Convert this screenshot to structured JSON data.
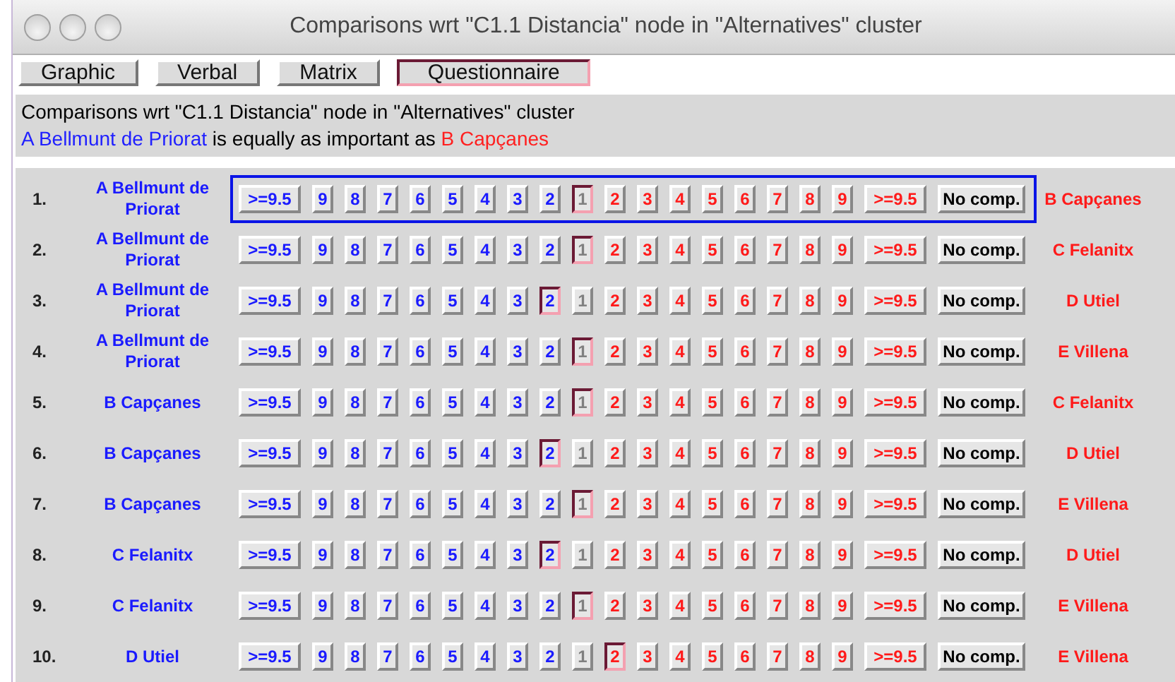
{
  "window": {
    "title": "Comparisons wrt \"C1.1 Distancia\" node in \"Alternatives\" cluster"
  },
  "tabs": [
    {
      "label": "Graphic",
      "selected": false
    },
    {
      "label": "Verbal",
      "selected": false
    },
    {
      "label": "Matrix",
      "selected": false
    },
    {
      "label": "Questionnaire",
      "selected": true
    }
  ],
  "info": {
    "heading": "Comparisons wrt \"C1.1 Distancia\" node in \"Alternatives\" cluster",
    "statement": [
      {
        "text": "A Bellmunt de Priorat",
        "color": "#2020ff"
      },
      {
        "text": " is equally as important as ",
        "color": "#000000"
      },
      {
        "text": "B Capçanes",
        "color": "#ff2020"
      }
    ]
  },
  "rows": [
    {
      "number": "1.",
      "left": "A Bellmunt de Priorat",
      "right": "B Capçanes",
      "focused": true,
      "buttons": [
        {
          "label": ">=9.5",
          "kind": "left",
          "selected": false
        },
        {
          "label": "9",
          "kind": "left",
          "selected": false
        },
        {
          "label": "8",
          "kind": "left",
          "selected": false
        },
        {
          "label": "7",
          "kind": "left",
          "selected": false
        },
        {
          "label": "6",
          "kind": "left",
          "selected": false
        },
        {
          "label": "5",
          "kind": "left",
          "selected": false
        },
        {
          "label": "4",
          "kind": "left",
          "selected": false
        },
        {
          "label": "3",
          "kind": "left",
          "selected": false
        },
        {
          "label": "2",
          "kind": "left",
          "selected": false
        },
        {
          "label": "1",
          "kind": "equal",
          "selected": true
        },
        {
          "label": "2",
          "kind": "right",
          "selected": false
        },
        {
          "label": "3",
          "kind": "right",
          "selected": false
        },
        {
          "label": "4",
          "kind": "right",
          "selected": false
        },
        {
          "label": "5",
          "kind": "right",
          "selected": false
        },
        {
          "label": "6",
          "kind": "right",
          "selected": false
        },
        {
          "label": "7",
          "kind": "right",
          "selected": false
        },
        {
          "label": "8",
          "kind": "right",
          "selected": false
        },
        {
          "label": "9",
          "kind": "right",
          "selected": false
        },
        {
          "label": ">=9.5",
          "kind": "right",
          "selected": false
        },
        {
          "label": "No comp.",
          "kind": "none",
          "selected": false
        }
      ]
    },
    {
      "number": "2.",
      "left": "A Bellmunt de Priorat",
      "right": "C Felanitx",
      "focused": false,
      "buttons": [
        {
          "label": ">=9.5",
          "kind": "left",
          "selected": false
        },
        {
          "label": "9",
          "kind": "left",
          "selected": false
        },
        {
          "label": "8",
          "kind": "left",
          "selected": false
        },
        {
          "label": "7",
          "kind": "left",
          "selected": false
        },
        {
          "label": "6",
          "kind": "left",
          "selected": false
        },
        {
          "label": "5",
          "kind": "left",
          "selected": false
        },
        {
          "label": "4",
          "kind": "left",
          "selected": false
        },
        {
          "label": "3",
          "kind": "left",
          "selected": false
        },
        {
          "label": "2",
          "kind": "left",
          "selected": false
        },
        {
          "label": "1",
          "kind": "equal",
          "selected": true
        },
        {
          "label": "2",
          "kind": "right",
          "selected": false
        },
        {
          "label": "3",
          "kind": "right",
          "selected": false
        },
        {
          "label": "4",
          "kind": "right",
          "selected": false
        },
        {
          "label": "5",
          "kind": "right",
          "selected": false
        },
        {
          "label": "6",
          "kind": "right",
          "selected": false
        },
        {
          "label": "7",
          "kind": "right",
          "selected": false
        },
        {
          "label": "8",
          "kind": "right",
          "selected": false
        },
        {
          "label": "9",
          "kind": "right",
          "selected": false
        },
        {
          "label": ">=9.5",
          "kind": "right",
          "selected": false
        },
        {
          "label": "No comp.",
          "kind": "none",
          "selected": false
        }
      ]
    },
    {
      "number": "3.",
      "left": "A Bellmunt de Priorat",
      "right": "D Utiel",
      "focused": false,
      "buttons": [
        {
          "label": ">=9.5",
          "kind": "left",
          "selected": false
        },
        {
          "label": "9",
          "kind": "left",
          "selected": false
        },
        {
          "label": "8",
          "kind": "left",
          "selected": false
        },
        {
          "label": "7",
          "kind": "left",
          "selected": false
        },
        {
          "label": "6",
          "kind": "left",
          "selected": false
        },
        {
          "label": "5",
          "kind": "left",
          "selected": false
        },
        {
          "label": "4",
          "kind": "left",
          "selected": false
        },
        {
          "label": "3",
          "kind": "left",
          "selected": false
        },
        {
          "label": "2",
          "kind": "left",
          "selected": true
        },
        {
          "label": "1",
          "kind": "equal",
          "selected": false
        },
        {
          "label": "2",
          "kind": "right",
          "selected": false
        },
        {
          "label": "3",
          "kind": "right",
          "selected": false
        },
        {
          "label": "4",
          "kind": "right",
          "selected": false
        },
        {
          "label": "5",
          "kind": "right",
          "selected": false
        },
        {
          "label": "6",
          "kind": "right",
          "selected": false
        },
        {
          "label": "7",
          "kind": "right",
          "selected": false
        },
        {
          "label": "8",
          "kind": "right",
          "selected": false
        },
        {
          "label": "9",
          "kind": "right",
          "selected": false
        },
        {
          "label": ">=9.5",
          "kind": "right",
          "selected": false
        },
        {
          "label": "No comp.",
          "kind": "none",
          "selected": false
        }
      ]
    },
    {
      "number": "4.",
      "left": "A Bellmunt de Priorat",
      "right": "E Villena",
      "focused": false,
      "buttons": [
        {
          "label": ">=9.5",
          "kind": "left",
          "selected": false
        },
        {
          "label": "9",
          "kind": "left",
          "selected": false
        },
        {
          "label": "8",
          "kind": "left",
          "selected": false
        },
        {
          "label": "7",
          "kind": "left",
          "selected": false
        },
        {
          "label": "6",
          "kind": "left",
          "selected": false
        },
        {
          "label": "5",
          "kind": "left",
          "selected": false
        },
        {
          "label": "4",
          "kind": "left",
          "selected": false
        },
        {
          "label": "3",
          "kind": "left",
          "selected": false
        },
        {
          "label": "2",
          "kind": "left",
          "selected": false
        },
        {
          "label": "1",
          "kind": "equal",
          "selected": true
        },
        {
          "label": "2",
          "kind": "right",
          "selected": false
        },
        {
          "label": "3",
          "kind": "right",
          "selected": false
        },
        {
          "label": "4",
          "kind": "right",
          "selected": false
        },
        {
          "label": "5",
          "kind": "right",
          "selected": false
        },
        {
          "label": "6",
          "kind": "right",
          "selected": false
        },
        {
          "label": "7",
          "kind": "right",
          "selected": false
        },
        {
          "label": "8",
          "kind": "right",
          "selected": false
        },
        {
          "label": "9",
          "kind": "right",
          "selected": false
        },
        {
          "label": ">=9.5",
          "kind": "right",
          "selected": false
        },
        {
          "label": "No comp.",
          "kind": "none",
          "selected": false
        }
      ]
    },
    {
      "number": "5.",
      "left": "B Capçanes",
      "right": "C Felanitx",
      "focused": false,
      "buttons": [
        {
          "label": ">=9.5",
          "kind": "left",
          "selected": false
        },
        {
          "label": "9",
          "kind": "left",
          "selected": false
        },
        {
          "label": "8",
          "kind": "left",
          "selected": false
        },
        {
          "label": "7",
          "kind": "left",
          "selected": false
        },
        {
          "label": "6",
          "kind": "left",
          "selected": false
        },
        {
          "label": "5",
          "kind": "left",
          "selected": false
        },
        {
          "label": "4",
          "kind": "left",
          "selected": false
        },
        {
          "label": "3",
          "kind": "left",
          "selected": false
        },
        {
          "label": "2",
          "kind": "left",
          "selected": false
        },
        {
          "label": "1",
          "kind": "equal",
          "selected": true
        },
        {
          "label": "2",
          "kind": "right",
          "selected": false
        },
        {
          "label": "3",
          "kind": "right",
          "selected": false
        },
        {
          "label": "4",
          "kind": "right",
          "selected": false
        },
        {
          "label": "5",
          "kind": "right",
          "selected": false
        },
        {
          "label": "6",
          "kind": "right",
          "selected": false
        },
        {
          "label": "7",
          "kind": "right",
          "selected": false
        },
        {
          "label": "8",
          "kind": "right",
          "selected": false
        },
        {
          "label": "9",
          "kind": "right",
          "selected": false
        },
        {
          "label": ">=9.5",
          "kind": "right",
          "selected": false
        },
        {
          "label": "No comp.",
          "kind": "none",
          "selected": false
        }
      ]
    },
    {
      "number": "6.",
      "left": "B Capçanes",
      "right": "D Utiel",
      "focused": false,
      "buttons": [
        {
          "label": ">=9.5",
          "kind": "left",
          "selected": false
        },
        {
          "label": "9",
          "kind": "left",
          "selected": false
        },
        {
          "label": "8",
          "kind": "left",
          "selected": false
        },
        {
          "label": "7",
          "kind": "left",
          "selected": false
        },
        {
          "label": "6",
          "kind": "left",
          "selected": false
        },
        {
          "label": "5",
          "kind": "left",
          "selected": false
        },
        {
          "label": "4",
          "kind": "left",
          "selected": false
        },
        {
          "label": "3",
          "kind": "left",
          "selected": false
        },
        {
          "label": "2",
          "kind": "left",
          "selected": true
        },
        {
          "label": "1",
          "kind": "equal",
          "selected": false
        },
        {
          "label": "2",
          "kind": "right",
          "selected": false
        },
        {
          "label": "3",
          "kind": "right",
          "selected": false
        },
        {
          "label": "4",
          "kind": "right",
          "selected": false
        },
        {
          "label": "5",
          "kind": "right",
          "selected": false
        },
        {
          "label": "6",
          "kind": "right",
          "selected": false
        },
        {
          "label": "7",
          "kind": "right",
          "selected": false
        },
        {
          "label": "8",
          "kind": "right",
          "selected": false
        },
        {
          "label": "9",
          "kind": "right",
          "selected": false
        },
        {
          "label": ">=9.5",
          "kind": "right",
          "selected": false
        },
        {
          "label": "No comp.",
          "kind": "none",
          "selected": false
        }
      ]
    },
    {
      "number": "7.",
      "left": "B Capçanes",
      "right": "E Villena",
      "focused": false,
      "buttons": [
        {
          "label": ">=9.5",
          "kind": "left",
          "selected": false
        },
        {
          "label": "9",
          "kind": "left",
          "selected": false
        },
        {
          "label": "8",
          "kind": "left",
          "selected": false
        },
        {
          "label": "7",
          "kind": "left",
          "selected": false
        },
        {
          "label": "6",
          "kind": "left",
          "selected": false
        },
        {
          "label": "5",
          "kind": "left",
          "selected": false
        },
        {
          "label": "4",
          "kind": "left",
          "selected": false
        },
        {
          "label": "3",
          "kind": "left",
          "selected": false
        },
        {
          "label": "2",
          "kind": "left",
          "selected": false
        },
        {
          "label": "1",
          "kind": "equal",
          "selected": true
        },
        {
          "label": "2",
          "kind": "right",
          "selected": false
        },
        {
          "label": "3",
          "kind": "right",
          "selected": false
        },
        {
          "label": "4",
          "kind": "right",
          "selected": false
        },
        {
          "label": "5",
          "kind": "right",
          "selected": false
        },
        {
          "label": "6",
          "kind": "right",
          "selected": false
        },
        {
          "label": "7",
          "kind": "right",
          "selected": false
        },
        {
          "label": "8",
          "kind": "right",
          "selected": false
        },
        {
          "label": "9",
          "kind": "right",
          "selected": false
        },
        {
          "label": ">=9.5",
          "kind": "right",
          "selected": false
        },
        {
          "label": "No comp.",
          "kind": "none",
          "selected": false
        }
      ]
    },
    {
      "number": "8.",
      "left": "C Felanitx",
      "right": "D Utiel",
      "focused": false,
      "buttons": [
        {
          "label": ">=9.5",
          "kind": "left",
          "selected": false
        },
        {
          "label": "9",
          "kind": "left",
          "selected": false
        },
        {
          "label": "8",
          "kind": "left",
          "selected": false
        },
        {
          "label": "7",
          "kind": "left",
          "selected": false
        },
        {
          "label": "6",
          "kind": "left",
          "selected": false
        },
        {
          "label": "5",
          "kind": "left",
          "selected": false
        },
        {
          "label": "4",
          "kind": "left",
          "selected": false
        },
        {
          "label": "3",
          "kind": "left",
          "selected": false
        },
        {
          "label": "2",
          "kind": "left",
          "selected": true
        },
        {
          "label": "1",
          "kind": "equal",
          "selected": false
        },
        {
          "label": "2",
          "kind": "right",
          "selected": false
        },
        {
          "label": "3",
          "kind": "right",
          "selected": false
        },
        {
          "label": "4",
          "kind": "right",
          "selected": false
        },
        {
          "label": "5",
          "kind": "right",
          "selected": false
        },
        {
          "label": "6",
          "kind": "right",
          "selected": false
        },
        {
          "label": "7",
          "kind": "right",
          "selected": false
        },
        {
          "label": "8",
          "kind": "right",
          "selected": false
        },
        {
          "label": "9",
          "kind": "right",
          "selected": false
        },
        {
          "label": ">=9.5",
          "kind": "right",
          "selected": false
        },
        {
          "label": "No comp.",
          "kind": "none",
          "selected": false
        }
      ]
    },
    {
      "number": "9.",
      "left": "C Felanitx",
      "right": "E Villena",
      "focused": false,
      "buttons": [
        {
          "label": ">=9.5",
          "kind": "left",
          "selected": false
        },
        {
          "label": "9",
          "kind": "left",
          "selected": false
        },
        {
          "label": "8",
          "kind": "left",
          "selected": false
        },
        {
          "label": "7",
          "kind": "left",
          "selected": false
        },
        {
          "label": "6",
          "kind": "left",
          "selected": false
        },
        {
          "label": "5",
          "kind": "left",
          "selected": false
        },
        {
          "label": "4",
          "kind": "left",
          "selected": false
        },
        {
          "label": "3",
          "kind": "left",
          "selected": false
        },
        {
          "label": "2",
          "kind": "left",
          "selected": false
        },
        {
          "label": "1",
          "kind": "equal",
          "selected": true
        },
        {
          "label": "2",
          "kind": "right",
          "selected": false
        },
        {
          "label": "3",
          "kind": "right",
          "selected": false
        },
        {
          "label": "4",
          "kind": "right",
          "selected": false
        },
        {
          "label": "5",
          "kind": "right",
          "selected": false
        },
        {
          "label": "6",
          "kind": "right",
          "selected": false
        },
        {
          "label": "7",
          "kind": "right",
          "selected": false
        },
        {
          "label": "8",
          "kind": "right",
          "selected": false
        },
        {
          "label": "9",
          "kind": "right",
          "selected": false
        },
        {
          "label": ">=9.5",
          "kind": "right",
          "selected": false
        },
        {
          "label": "No comp.",
          "kind": "none",
          "selected": false
        }
      ]
    },
    {
      "number": "10.",
      "left": "D Utiel",
      "right": "E Villena",
      "focused": false,
      "buttons": [
        {
          "label": ">=9.5",
          "kind": "left",
          "selected": false
        },
        {
          "label": "9",
          "kind": "left",
          "selected": false
        },
        {
          "label": "8",
          "kind": "left",
          "selected": false
        },
        {
          "label": "7",
          "kind": "left",
          "selected": false
        },
        {
          "label": "6",
          "kind": "left",
          "selected": false
        },
        {
          "label": "5",
          "kind": "left",
          "selected": false
        },
        {
          "label": "4",
          "kind": "left",
          "selected": false
        },
        {
          "label": "3",
          "kind": "left",
          "selected": false
        },
        {
          "label": "2",
          "kind": "left",
          "selected": false
        },
        {
          "label": "1",
          "kind": "equal",
          "selected": false
        },
        {
          "label": "2",
          "kind": "right",
          "selected": true
        },
        {
          "label": "3",
          "kind": "right",
          "selected": false
        },
        {
          "label": "4",
          "kind": "right",
          "selected": false
        },
        {
          "label": "5",
          "kind": "right",
          "selected": false
        },
        {
          "label": "6",
          "kind": "right",
          "selected": false
        },
        {
          "label": "7",
          "kind": "right",
          "selected": false
        },
        {
          "label": "8",
          "kind": "right",
          "selected": false
        },
        {
          "label": "9",
          "kind": "right",
          "selected": false
        },
        {
          "label": ">=9.5",
          "kind": "right",
          "selected": false
        },
        {
          "label": "No comp.",
          "kind": "none",
          "selected": false
        }
      ]
    }
  ]
}
